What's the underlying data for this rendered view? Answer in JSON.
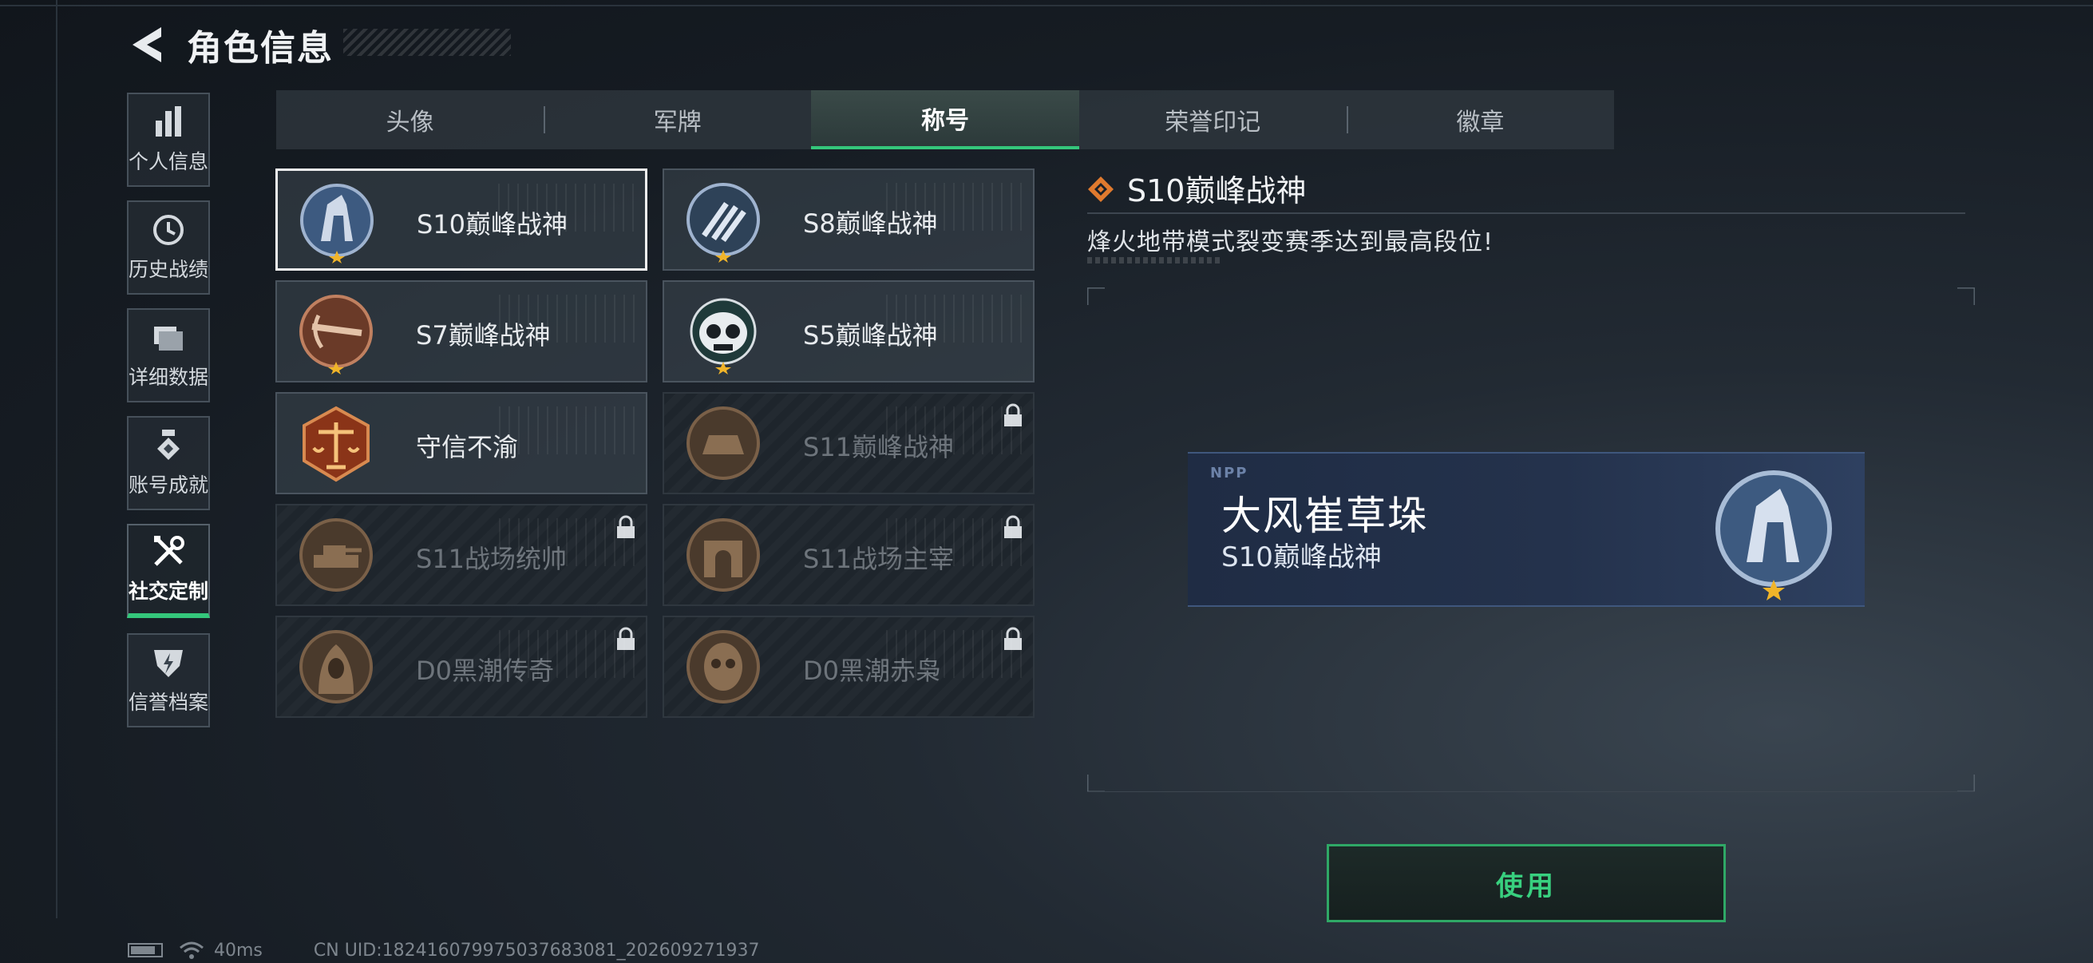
{
  "header": {
    "title": "角色信息"
  },
  "sidebar": {
    "items": [
      {
        "label": "个人信息",
        "icon": "bar-chart-icon"
      },
      {
        "label": "历史战绩",
        "icon": "clock-history-icon"
      },
      {
        "label": "详细数据",
        "icon": "folder-icon"
      },
      {
        "label": "账号成就",
        "icon": "medal-icon"
      },
      {
        "label": "社交定制",
        "icon": "tools-icon",
        "active": true
      },
      {
        "label": "信誉档案",
        "icon": "shield-bolt-icon"
      }
    ]
  },
  "tabs": [
    {
      "label": "头像"
    },
    {
      "label": "军牌"
    },
    {
      "label": "称号",
      "active": true
    },
    {
      "label": "荣誉印记"
    },
    {
      "label": "徽章"
    }
  ],
  "titles": [
    {
      "name": "S10巅峰战神",
      "selected": true,
      "locked": false,
      "icon": "tower-emblem-icon"
    },
    {
      "name": "S8巅峰战神",
      "selected": false,
      "locked": false,
      "icon": "slash-emblem-icon"
    },
    {
      "name": "S7巅峰战神",
      "selected": false,
      "locked": false,
      "icon": "crossbow-emblem-icon"
    },
    {
      "name": "S5巅峰战神",
      "selected": false,
      "locked": false,
      "icon": "skull-emblem-icon"
    },
    {
      "name": "守信不渝",
      "selected": false,
      "locked": false,
      "icon": "scales-emblem-icon"
    },
    {
      "name": "S11巅峰战神",
      "selected": false,
      "locked": true,
      "icon": "bronze-emblem-icon"
    },
    {
      "name": "S11战场统帅",
      "selected": false,
      "locked": true,
      "icon": "tank-emblem-icon"
    },
    {
      "name": "S11战场主宰",
      "selected": false,
      "locked": true,
      "icon": "arch-emblem-icon"
    },
    {
      "name": "D0黑潮传奇",
      "selected": false,
      "locked": true,
      "icon": "hooded-figure-emblem-icon"
    },
    {
      "name": "D0黑潮赤枭",
      "selected": false,
      "locked": true,
      "icon": "mask-emblem-icon"
    }
  ],
  "detail": {
    "title": "S10巅峰战神",
    "description": "烽火地带模式裂变赛季达到最高段位!"
  },
  "nameplate": {
    "tag": "NPP",
    "player_name": "大风崔草垛",
    "title": "S10巅峰战神"
  },
  "use_button": "使用",
  "status": {
    "ping": "40ms",
    "uid": "CN UID:182416079975037683081_202609271937"
  },
  "colors": {
    "accent": "#34c77b",
    "locked_text": "#6d747b",
    "nameplate_bg": "#24324c"
  }
}
